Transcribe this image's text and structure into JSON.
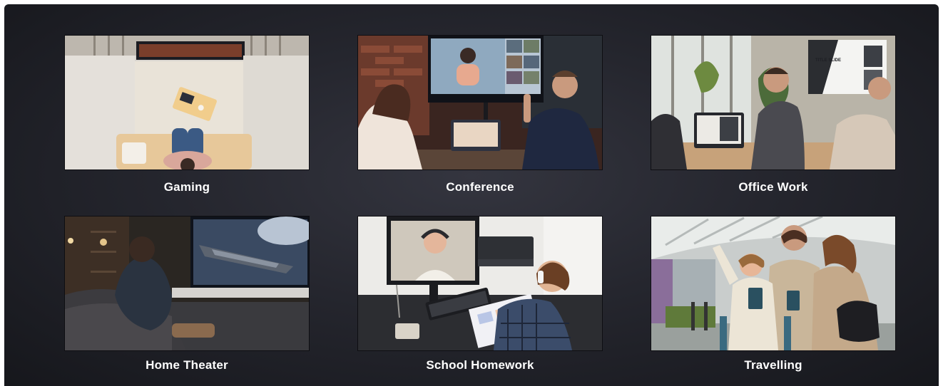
{
  "tiles": [
    {
      "id": "gaming",
      "label": "Gaming"
    },
    {
      "id": "conference",
      "label": "Conference"
    },
    {
      "id": "office-work",
      "label": "Office Work",
      "screen_title": "TITLE SLIDE"
    },
    {
      "id": "home-theater",
      "label": "Home Theater"
    },
    {
      "id": "school-homework",
      "label": "School Homework"
    },
    {
      "id": "travelling",
      "label": "Travelling"
    }
  ],
  "colors": {
    "panel_background": "#25262e",
    "caption_text": "#ffffff"
  }
}
